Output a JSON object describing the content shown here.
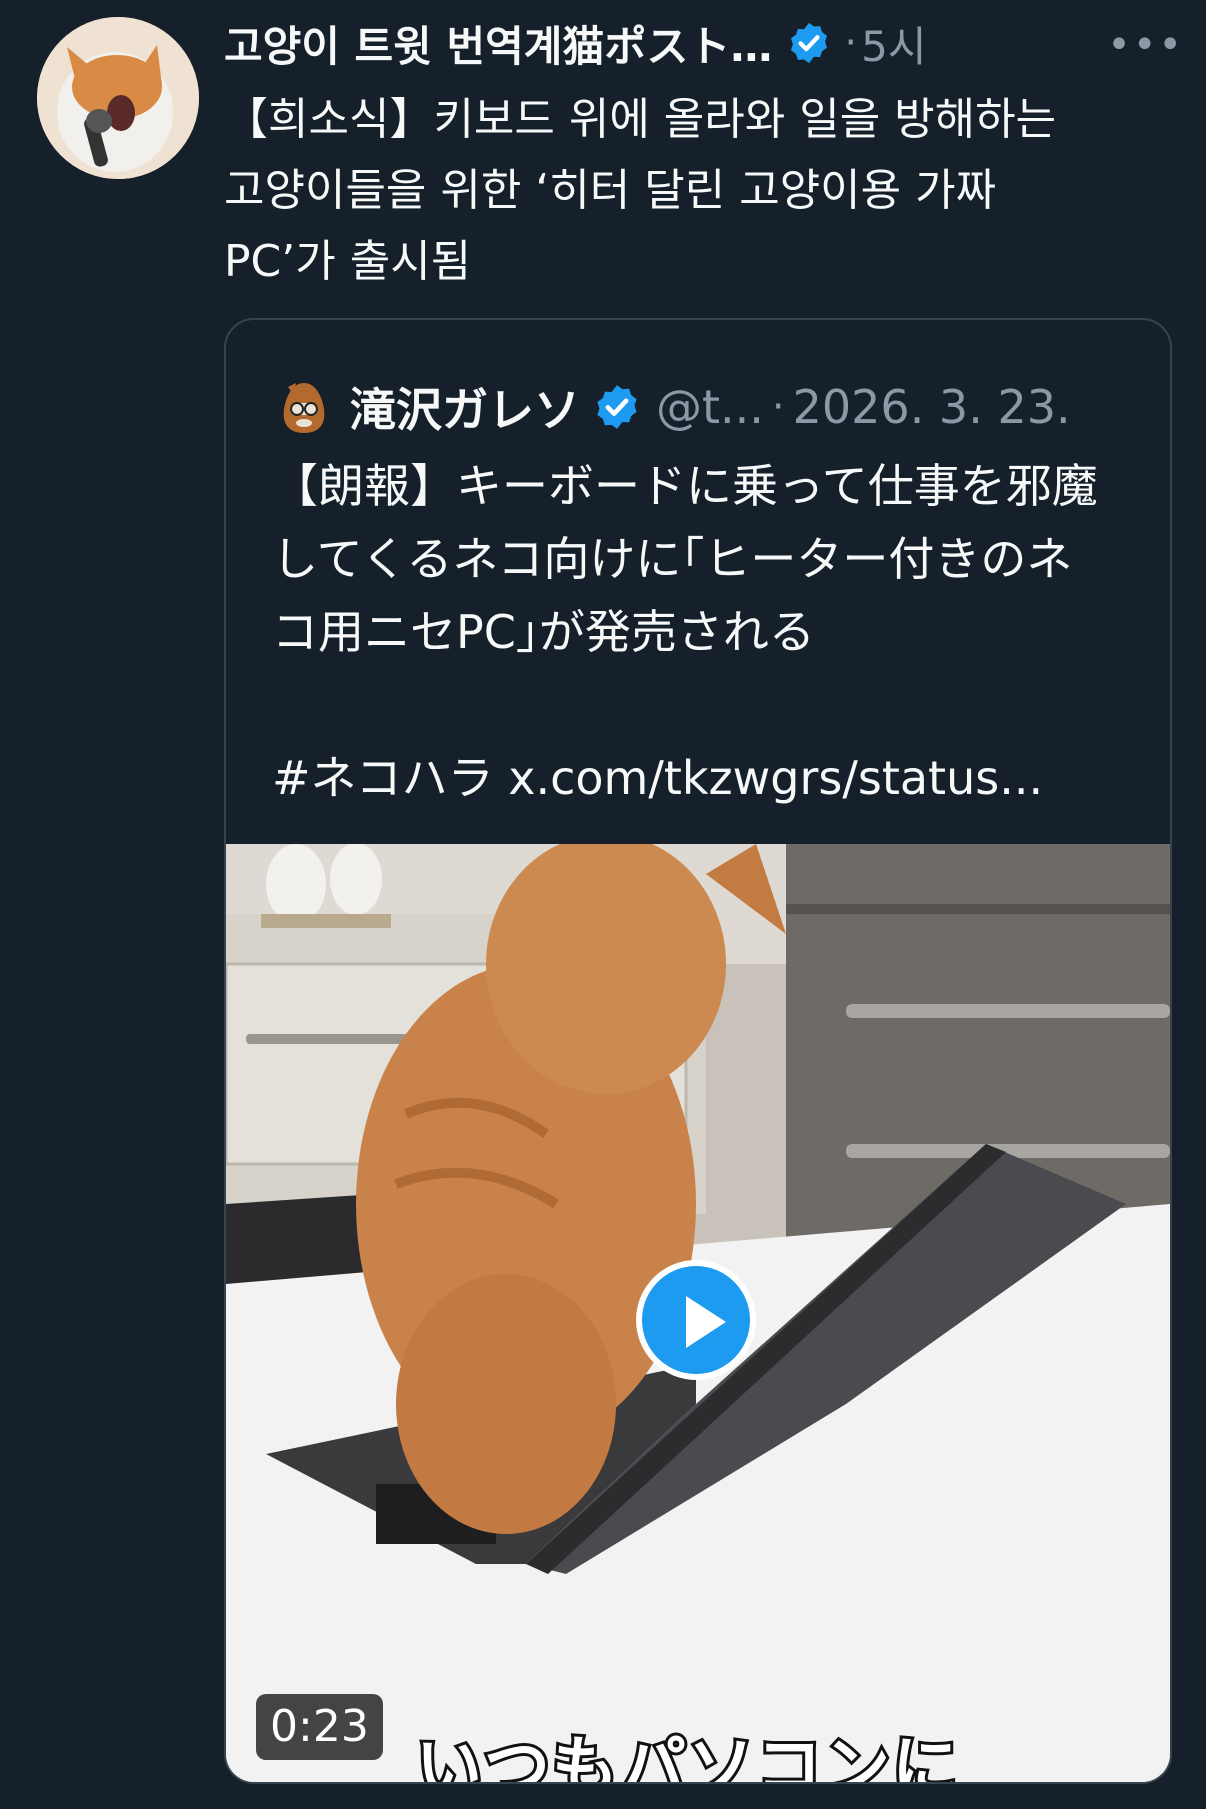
{
  "tweet": {
    "author_name": "고양이 트윗 번역계猫ポスト…",
    "verified_icon": "verified-badge-icon",
    "separator": "·",
    "time": "5시",
    "more_icon": "more-icon",
    "more_label": "•••",
    "text": "【희소식】키보드 위에 올라와 일을 방해하는\n고양이들을 위한 ‘히터 달린 고양이용 가짜\nPC’가 출시됨"
  },
  "quote": {
    "author_name": "滝沢ガレソ",
    "handle": "@t...",
    "separator": "·",
    "date": "2026. 3. 23.",
    "text": "【朗報】キーボードに乗って仕事を邪魔\nしてくるネコ向けに｢ヒーター付きのネ\nコ用ニセPC｣が発売される\n\n#ネコハラ x.com/tkzwgrs/status...",
    "media": {
      "type": "video",
      "duration": "0:23",
      "caption": "いつもパソコンに",
      "play_icon": "play-icon"
    }
  },
  "colors": {
    "background": "#15202b",
    "text": "#f7f9f9",
    "secondary": "#8b98a5",
    "border": "#38444d",
    "accent": "#1d9bf0"
  }
}
